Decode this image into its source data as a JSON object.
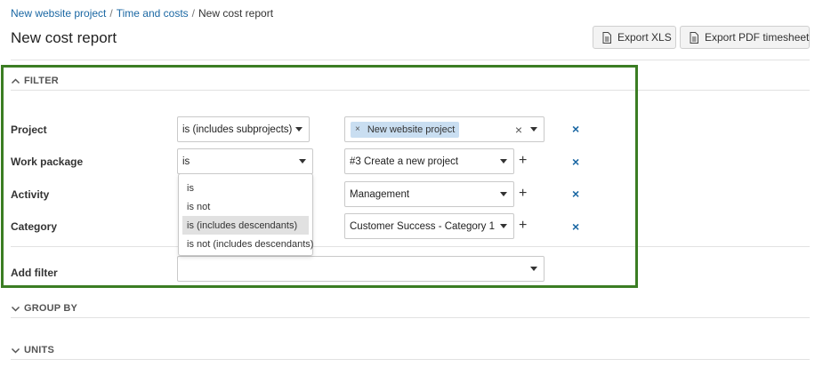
{
  "breadcrumb": {
    "items": [
      "New website project",
      "Time and costs",
      "New cost report"
    ],
    "separator": "/"
  },
  "page": {
    "title": "New cost report"
  },
  "toolbar": {
    "export_xls": "Export XLS",
    "export_pdf": "Export PDF timesheet",
    "icon": "document-icon"
  },
  "sections": {
    "filter": "FILTER",
    "group_by": "GROUP BY",
    "units": "UNITS"
  },
  "filters": [
    {
      "label": "Project",
      "operator": "is (includes subprojects)",
      "value_tag": "New website project",
      "value_tag_remove": "×",
      "clear": "×"
    },
    {
      "label": "Work package",
      "operator": "is",
      "value": "#3 Create a new project",
      "add": "+"
    },
    {
      "label": "Activity",
      "operator": "is",
      "value": "Management",
      "add": "+"
    },
    {
      "label": "Category",
      "operator": "is",
      "value": "Customer Success - Category 1",
      "add": "+"
    }
  ],
  "remove_symbol": "×",
  "add_filter": {
    "label": "Add filter",
    "value": ""
  },
  "operator_dropdown": {
    "options": [
      "is",
      "is not",
      "is (includes descendants)",
      "is not (includes descendants)"
    ],
    "highlighted": "is (includes descendants)"
  },
  "colors": {
    "link": "#1a67a3",
    "highlight_border": "#3b7d23",
    "tag_bg": "#c9def1"
  }
}
